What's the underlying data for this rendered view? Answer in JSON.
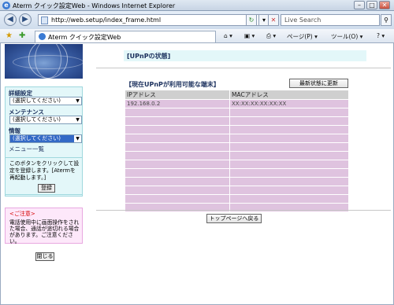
{
  "window": {
    "title": "Aterm クイック設定Web - Windows Internet Explorer",
    "btn_min": "–",
    "btn_max": "□",
    "btn_close": "✕"
  },
  "address": {
    "url": "http://web.setup/index_frame.html",
    "refresh_glyph": "↻",
    "stop_glyph": "✕",
    "search_placeholder": "Live Search",
    "search_glyph": "⚲"
  },
  "toolbar": {
    "tab_label": "Aterm クイック設定Web",
    "home": "⌂ ▾",
    "feeds": "▣ ▾",
    "print": "⎙ ▾",
    "page": "ページ(P) ▾",
    "tools": "ツール(O) ▾",
    "help": "? ▾"
  },
  "sidebar": {
    "detail_label": "詳細設定",
    "detail_value": "(選択してください)",
    "maint_label": "メンテナンス",
    "maint_value": "(選択してください)",
    "info_label": "情報",
    "info_value": "(選択してください)",
    "menu_list": "メニュー一覧",
    "info_text": "このボタンをクリックして設定を登録します。[Atermを再起動します。]",
    "register_button": "登録",
    "notice_heading": "<ご注意>",
    "notice_text": "電話使用中に画面操作をされた場合、通話が途切れる場合があります。ご注意ください。",
    "close_button": "閉じる"
  },
  "main": {
    "header": "[UPnPの状態]",
    "section_title": "【現在UPnPが利用可能な端末】",
    "refresh_button": "最新状態に更新",
    "columns": [
      "IPアドレス",
      "MACアドレス"
    ],
    "rows": [
      [
        "192.168.0.2",
        "XX:XX:XX:XX:XX:XX"
      ],
      [
        "",
        ""
      ],
      [
        "",
        ""
      ],
      [
        "",
        ""
      ],
      [
        "",
        ""
      ],
      [
        "",
        ""
      ],
      [
        "",
        ""
      ],
      [
        "",
        ""
      ],
      [
        "",
        ""
      ],
      [
        "",
        ""
      ],
      [
        "",
        ""
      ],
      [
        "",
        ""
      ],
      [
        "",
        ""
      ]
    ],
    "top_button": "トップページへ戻る"
  },
  "colors": {
    "menu_bg": "#e3f7f9",
    "table_row": "#dfc3df",
    "table_header": "#cfcfcf",
    "notice_bg": "#fde8fa",
    "notice_heading": "#d60000"
  }
}
